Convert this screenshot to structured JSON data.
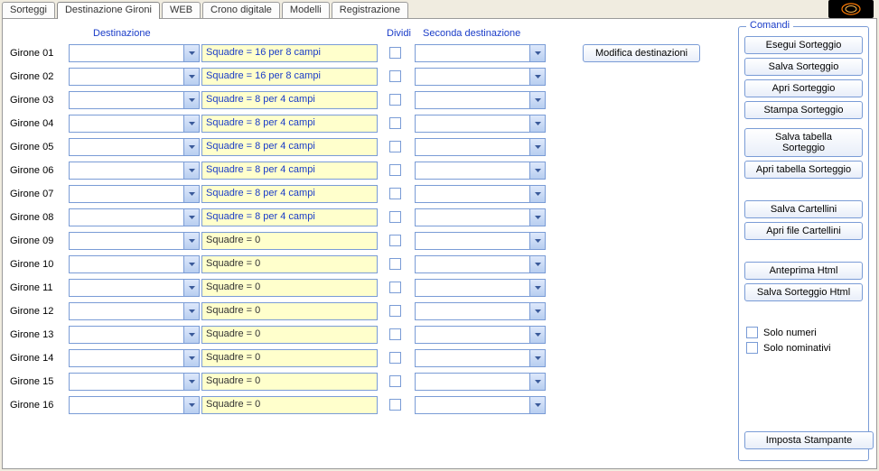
{
  "tabs": [
    "Sorteggi",
    "Destinazione Gironi",
    "WEB",
    "Crono digitale",
    "Modelli",
    "Registrazione"
  ],
  "activeTab": 1,
  "headers": {
    "dest": "Destinazione",
    "div": "Dividi",
    "sec": "Seconda destinazione"
  },
  "rows": [
    {
      "label": "Girone 01",
      "info": "Squadre = 16 per 8 campi",
      "zero": false
    },
    {
      "label": "Girone 02",
      "info": "Squadre = 16 per 8 campi",
      "zero": false
    },
    {
      "label": "Girone 03",
      "info": "Squadre = 8 per 4 campi",
      "zero": false
    },
    {
      "label": "Girone 04",
      "info": "Squadre = 8 per 4 campi",
      "zero": false
    },
    {
      "label": "Girone 05",
      "info": "Squadre = 8 per 4 campi",
      "zero": false
    },
    {
      "label": "Girone 06",
      "info": "Squadre = 8 per 4 campi",
      "zero": false
    },
    {
      "label": "Girone 07",
      "info": "Squadre = 8 per 4 campi",
      "zero": false
    },
    {
      "label": "Girone 08",
      "info": "Squadre = 8 per 4 campi",
      "zero": false
    },
    {
      "label": "Girone 09",
      "info": "Squadre = 0",
      "zero": true
    },
    {
      "label": "Girone 10",
      "info": "Squadre = 0",
      "zero": true
    },
    {
      "label": "Girone 11",
      "info": "Squadre = 0",
      "zero": true
    },
    {
      "label": "Girone 12",
      "info": "Squadre = 0",
      "zero": true
    },
    {
      "label": "Girone 13",
      "info": "Squadre = 0",
      "zero": true
    },
    {
      "label": "Girone 14",
      "info": "Squadre = 0",
      "zero": true
    },
    {
      "label": "Girone 15",
      "info": "Squadre = 0",
      "zero": true
    },
    {
      "label": "Girone 16",
      "info": "Squadre = 0",
      "zero": true
    }
  ],
  "modDest": "Modifica destinazioni",
  "cmd": {
    "title": "Comandi",
    "esegui": "Esegui Sorteggio",
    "salva": "Salva Sorteggio",
    "apri": "Apri Sorteggio",
    "stampa": "Stampa Sorteggio",
    "salvaTab": "Salva tabella Sorteggio",
    "apriTab": "Apri tabella Sorteggio",
    "salvaCart": "Salva Cartellini",
    "apriCart": "Apri file Cartellini",
    "antHtml": "Anteprima Html",
    "salvaHtml": "Salva Sorteggio Html",
    "soloNum": "Solo numeri",
    "soloNom": "Solo nominativi",
    "impStamp": "Imposta Stampante"
  }
}
